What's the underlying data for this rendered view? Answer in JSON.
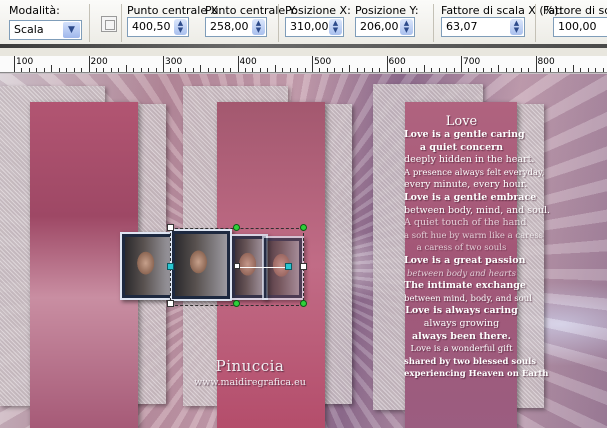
{
  "toolbar": {
    "mode": {
      "label": "Modalità:",
      "value": "Scala",
      "arrow": "chevron-down-icon"
    },
    "fields": [
      {
        "label": "Punto centrale X:",
        "value": "400,50"
      },
      {
        "label": "Punto centrale Y:",
        "value": "258,00"
      },
      {
        "label": "Posizione X:",
        "value": "310,00"
      },
      {
        "label": "Posizione Y:",
        "value": "206,00"
      },
      {
        "label": "Fattore di scala X (%):",
        "value": "63,07"
      },
      {
        "label": "Fattore di scala",
        "value": "100,00"
      }
    ]
  },
  "ruler": {
    "labels": [
      "100",
      "200",
      "300",
      "400",
      "500",
      "600",
      "700",
      "800"
    ]
  },
  "canvas": {
    "poem_lines": [
      "Love",
      "Love is a gentle caring",
      "a quiet concern",
      "deeply hidden in the heart.",
      "A presence always felt everyday,",
      "every minute, every hour.",
      "Love is a gentle embrace",
      "between body, mind, and soul.",
      "A quiet touch of the hand",
      "a soft hue by warm like a caress",
      "a caress of two souls",
      "Love is a great passion",
      "between body and hearts",
      "The intimate exchange",
      "between mind, body, and soul",
      "Love is always caring",
      "always growing",
      "always been there.",
      "Love is a wonderful gift",
      "shared by two blessed souls",
      "experiencing Heaven on Earth"
    ],
    "signature": {
      "name": "Pinuccia",
      "url": "www.maidiregrafica.eu"
    }
  }
}
